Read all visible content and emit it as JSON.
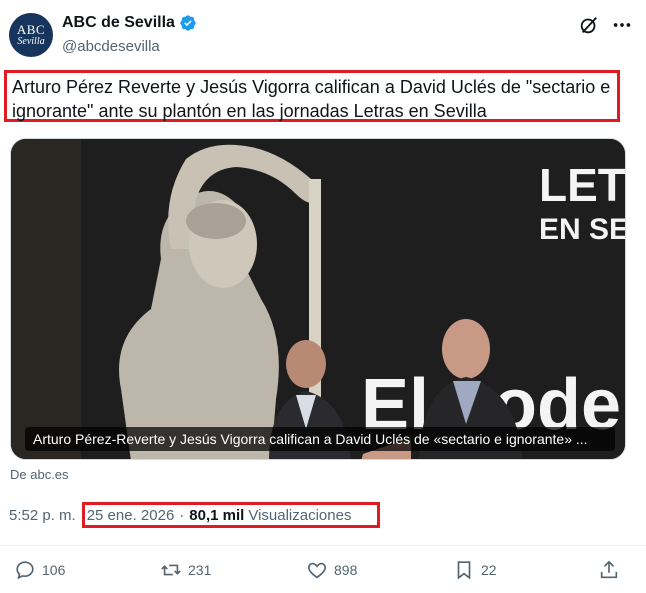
{
  "author": {
    "avatar_line1": "ABC",
    "avatar_line2": "Sevilla",
    "display_name": "ABC de Sevilla",
    "handle": "@abcdesevilla",
    "verified": true
  },
  "tweet": {
    "text": "Arturo Pérez Reverte y Jesús Vigorra califican a David Uclés de \"sectario e ignorante\" ante su plantón en las jornadas Letras en Sevilla"
  },
  "media": {
    "banner_text_1": "LET",
    "banner_text_2": "EN SE",
    "banner_text_3": "El poder d",
    "caption": "Arturo Pérez-Reverte y Jesús Vigorra califican a David Uclés de «sectario e ignorante» ...",
    "source": "De abc.es"
  },
  "meta": {
    "time": "5:52 p. m.",
    "date": "25 ene. 2026",
    "separator": "·",
    "views_count": "80,1 mil",
    "views_label": "Visualizaciones"
  },
  "actions": {
    "replies": "106",
    "reposts": "231",
    "likes": "898",
    "bookmarks": "22"
  },
  "colors": {
    "highlight": "#e01b24",
    "verified": "#1d9bf0",
    "secondary_text": "#536471",
    "avatar_bg": "#16345c"
  },
  "icons": [
    "verified-badge-icon",
    "grok-icon",
    "more-icon",
    "reply-icon",
    "repost-icon",
    "like-icon",
    "bookmark-icon",
    "share-icon"
  ]
}
